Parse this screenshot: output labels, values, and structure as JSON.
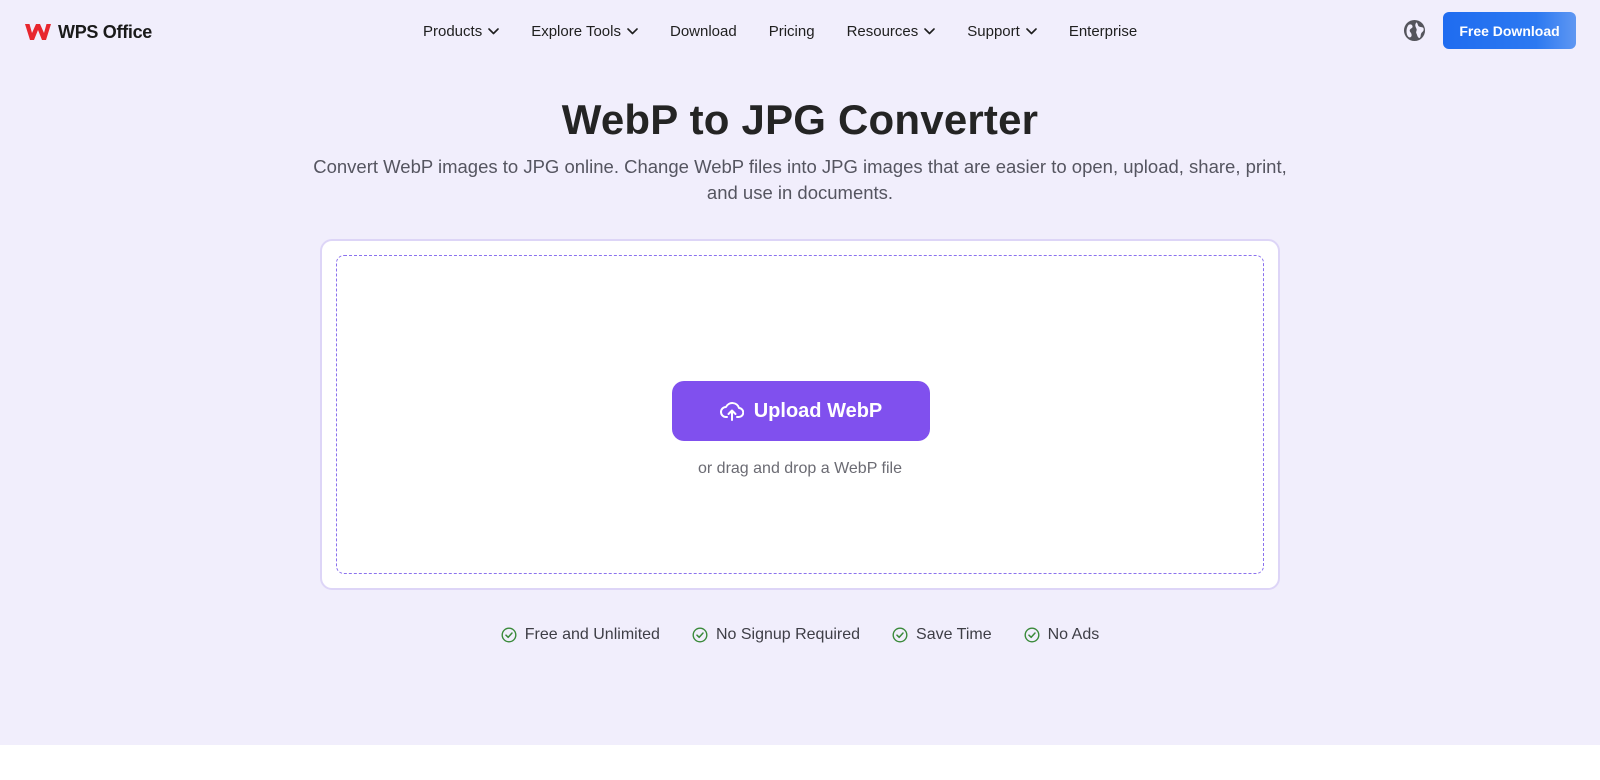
{
  "brand": {
    "name": "WPS Office",
    "color": "#e8262e"
  },
  "nav": {
    "items": [
      {
        "label": "Products",
        "dropdown": true
      },
      {
        "label": "Explore Tools",
        "dropdown": true
      },
      {
        "label": "Download",
        "dropdown": false
      },
      {
        "label": "Pricing",
        "dropdown": false
      },
      {
        "label": "Resources",
        "dropdown": true
      },
      {
        "label": "Support",
        "dropdown": true
      },
      {
        "label": "Enterprise",
        "dropdown": false
      }
    ],
    "language_icon": "globe-icon",
    "cta_label": "Free Download"
  },
  "hero": {
    "title": "WebP to JPG Converter",
    "subtitle": "Convert WebP images to JPG online. Change WebP files into JPG images that are easier to open, upload, share, print, and use in documents."
  },
  "uploader": {
    "button_label": "Upload WebP",
    "button_icon": "cloud-upload-icon",
    "hint": "or drag and drop a WebP file"
  },
  "features": [
    {
      "label": "Free and Unlimited",
      "icon": "check-circle-icon"
    },
    {
      "label": "No Signup Required",
      "icon": "check-circle-icon"
    },
    {
      "label": "Save Time",
      "icon": "check-circle-icon"
    },
    {
      "label": "No Ads",
      "icon": "check-circle-icon"
    }
  ],
  "colors": {
    "hero_background": "#f1eefc",
    "cta_blue": "#1f6cf0",
    "upload_purple": "#8050ee",
    "check_green": "#3a8a3a"
  }
}
